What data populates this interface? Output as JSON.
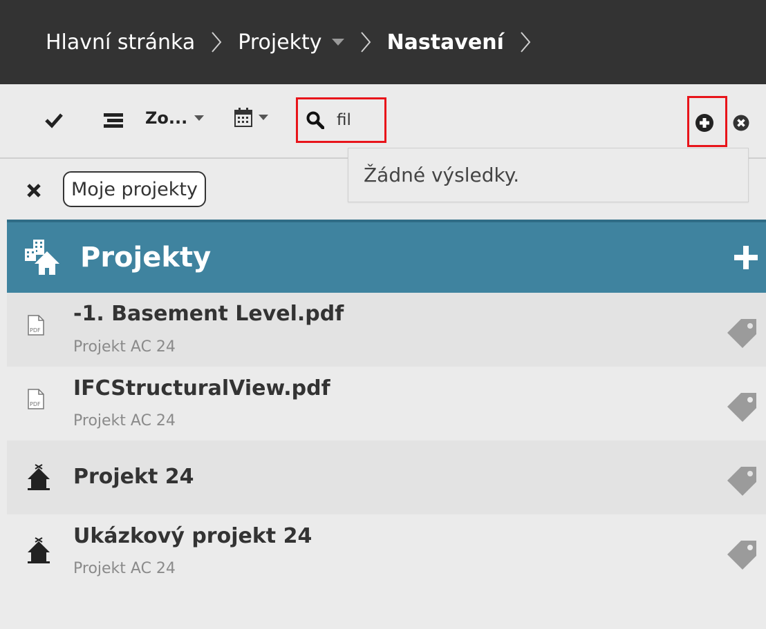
{
  "breadcrumb": {
    "home": "Hlavní stránka",
    "projects": "Projekty",
    "current": "Nastavení"
  },
  "toolbar": {
    "sort_label": "Zo...",
    "search_value": "fil",
    "search_no_results": "Žádné výsledky."
  },
  "filter": {
    "chip_label": "Moje projekty"
  },
  "section": {
    "title": "Projekty"
  },
  "items": [
    {
      "title": "-1. Basement Level.pdf",
      "subtitle": "Projekt AC 24",
      "icon": "pdf-file-icon"
    },
    {
      "title": "IFCStructuralView.pdf",
      "subtitle": "Projekt AC 24",
      "icon": "pdf-file-icon"
    },
    {
      "title": "Projekt 24",
      "subtitle": "",
      "icon": "house-icon"
    },
    {
      "title": "Ukázkový projekt 24",
      "subtitle": "Projekt AC 24",
      "icon": "house-icon"
    }
  ],
  "colors": {
    "topbar": "#333333",
    "header": "#3f839f",
    "highlight": "#e8141a",
    "row_a": "#e3e3e3",
    "row_b": "#ebebeb"
  }
}
